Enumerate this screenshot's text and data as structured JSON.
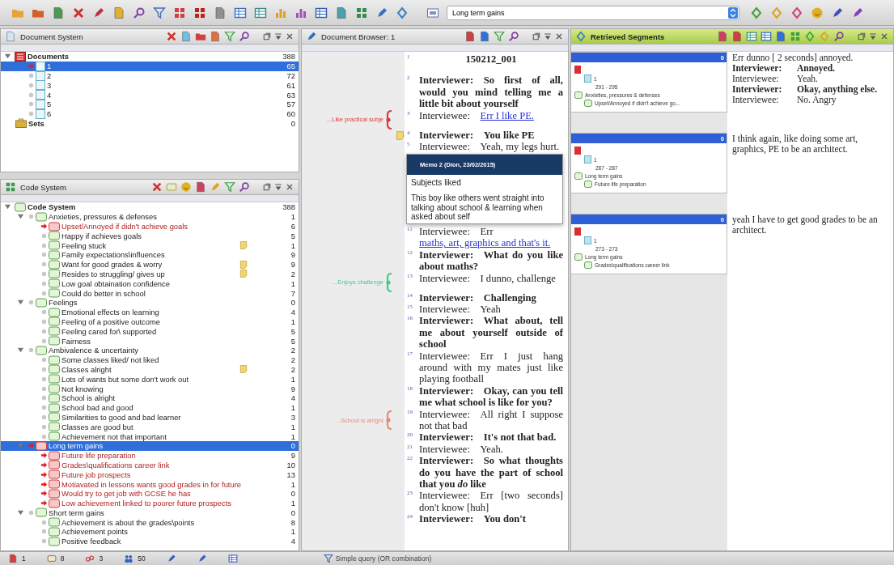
{
  "toolbar": {
    "code_dropdown": "Long term gains"
  },
  "document_system": {
    "title": "Document System",
    "root": {
      "name": "Documents",
      "count": "388",
      "expanded": true,
      "children": [
        {
          "name": "1",
          "count": "65",
          "selected": true,
          "activated": true
        },
        {
          "name": "2",
          "count": "72",
          "selected": false,
          "activated": false
        },
        {
          "name": "3",
          "count": "61",
          "selected": false,
          "activated": false
        },
        {
          "name": "4",
          "count": "63",
          "selected": false,
          "activated": false
        },
        {
          "name": "5",
          "count": "57",
          "selected": false,
          "activated": false
        },
        {
          "name": "6",
          "count": "60",
          "selected": false,
          "activated": false
        }
      ]
    },
    "sets": {
      "name": "Sets",
      "count": "0"
    }
  },
  "code_system": {
    "title": "Code System",
    "root": {
      "name": "Code System",
      "count": "388",
      "expanded": true,
      "children": [
        {
          "name": "Anxieties, pressures & defenses",
          "count": "1",
          "expanded": true,
          "selected": false,
          "activated": false,
          "children": [
            {
              "name": "Upset/Annoyed if didn't achieve goals",
              "count": "6",
              "selected": false,
              "activated": true,
              "memo": false
            },
            {
              "name": "Happy if achieves goals",
              "count": "5",
              "selected": false,
              "activated": false,
              "memo": false
            },
            {
              "name": "Feeling stuck",
              "count": "1",
              "selected": false,
              "activated": false,
              "memo": true
            },
            {
              "name": "Family expectations\\influences",
              "count": "9",
              "selected": false,
              "activated": false,
              "memo": false
            },
            {
              "name": "Want for good grades & worry",
              "count": "9",
              "selected": false,
              "activated": false,
              "memo": true
            },
            {
              "name": "Resides to struggling/ gives up",
              "count": "2",
              "selected": false,
              "activated": false,
              "memo": true
            },
            {
              "name": "Low goal obtaination confidence",
              "count": "1",
              "selected": false,
              "activated": false,
              "memo": false
            },
            {
              "name": "Could do better in school",
              "count": "7",
              "selected": false,
              "activated": false,
              "memo": false
            }
          ]
        },
        {
          "name": "Feelings",
          "count": "0",
          "expanded": true,
          "selected": false,
          "activated": false,
          "children": [
            {
              "name": "Emotional effects on learning",
              "count": "4",
              "selected": false,
              "activated": false,
              "memo": false
            },
            {
              "name": "Feeling of a positive outcome",
              "count": "1",
              "selected": false,
              "activated": false,
              "memo": false
            },
            {
              "name": "Feeling cared for\\ supported",
              "count": "5",
              "selected": false,
              "activated": false,
              "memo": false
            },
            {
              "name": "Fairness",
              "count": "5",
              "selected": false,
              "activated": false,
              "memo": false
            }
          ]
        },
        {
          "name": "Ambivalence & uncertainty",
          "count": "2",
          "expanded": true,
          "selected": false,
          "activated": false,
          "children": [
            {
              "name": "Some classes liked/ not liked",
              "count": "2",
              "selected": false,
              "activated": false,
              "memo": false
            },
            {
              "name": "Classes alright",
              "count": "2",
              "selected": false,
              "activated": false,
              "memo": true
            },
            {
              "name": "Lots of wants but some don't work out",
              "count": "1",
              "selected": false,
              "activated": false,
              "memo": false
            },
            {
              "name": "Not knowing",
              "count": "9",
              "selected": false,
              "activated": false,
              "memo": false
            },
            {
              "name": "School is alright",
              "count": "4",
              "selected": false,
              "activated": false,
              "memo": false
            },
            {
              "name": "School bad and good",
              "count": "1",
              "selected": false,
              "activated": false,
              "memo": false
            },
            {
              "name": "Similarities to good and bad learner",
              "count": "3",
              "selected": false,
              "activated": false,
              "memo": false
            },
            {
              "name": "Classes are good but",
              "count": "1",
              "selected": false,
              "activated": false,
              "memo": false
            },
            {
              "name": "Achievement not that important",
              "count": "1",
              "selected": false,
              "activated": false,
              "memo": false
            }
          ]
        },
        {
          "name": "Long term gains",
          "count": "0",
          "expanded": true,
          "selected": true,
          "activated": true,
          "children": [
            {
              "name": "Future life preparation",
              "count": "9",
              "selected": false,
              "activated": true,
              "memo": false
            },
            {
              "name": "Grades\\qualifications career link",
              "count": "10",
              "selected": false,
              "activated": true,
              "memo": false
            },
            {
              "name": "Future job prospects",
              "count": "13",
              "selected": false,
              "activated": true,
              "memo": false
            },
            {
              "name": "Motiavated in lessons wants good grades in for future",
              "count": "1",
              "selected": false,
              "activated": true,
              "memo": false
            },
            {
              "name": "Would try to get job with GCSE he has",
              "count": "0",
              "selected": false,
              "activated": true,
              "memo": false
            },
            {
              "name": "Low achievement linked to poorer future prospects",
              "count": "1",
              "selected": false,
              "activated": true,
              "memo": false
            }
          ]
        },
        {
          "name": "Short term gains",
          "count": "0",
          "expanded": true,
          "selected": false,
          "activated": false,
          "children": [
            {
              "name": "Achievement is about the grades\\points",
              "count": "8",
              "selected": false,
              "activated": false,
              "memo": false
            },
            {
              "name": "Achievement points",
              "count": "1",
              "selected": false,
              "activated": false,
              "memo": false
            },
            {
              "name": "Positive feedback",
              "count": "4",
              "selected": false,
              "activated": false,
              "memo": false
            }
          ]
        }
      ]
    }
  },
  "document_browser": {
    "title": "Document Browser: 1",
    "lines": [
      {
        "kind": "title",
        "n": "1",
        "text": "150212_001"
      },
      {
        "kind": "interviewer",
        "n": "2",
        "speaker": "Interviewer:",
        "text": "So first of all, would you mind telling me a little bit about yourself"
      },
      {
        "kind": "interviewee",
        "n": "3",
        "speaker": "Interviewee:",
        "link": "Err I like PE",
        "after": ".",
        "code": {
          "label": "...Like practical subje",
          "color": "#e0393e"
        }
      },
      {
        "kind": "interviewer",
        "n": "4",
        "speaker": "Interviewer:",
        "text": "You like PE",
        "memo": true
      },
      {
        "kind": "interviewee",
        "n": "5",
        "speaker": "Interviewee:",
        "text": "Yeah, my legs hurt."
      },
      {
        "kind": "memo",
        "title": "Memo 2 (Dion, 23/02/2015)",
        "subject": "Subjects liked",
        "body": "This boy like others went straight into talking about school & learning when asked about self"
      },
      {
        "kind": "interviewee",
        "n": "11",
        "speaker": "Interviewee:",
        "text": "Err",
        "link": "maths, art, graphics and that's it",
        "after": "."
      },
      {
        "kind": "interviewer",
        "n": "12",
        "speaker": "Interviewer:",
        "text": "What do you like about maths?"
      },
      {
        "kind": "interviewee",
        "n": "13",
        "speaker": "Interviewee:",
        "text": "I dunno, challenge",
        "code": {
          "label": "...Enjoys challenge",
          "color": "#3ecf8e"
        }
      },
      {
        "kind": "interviewer",
        "n": "14",
        "speaker": "Interviewer:",
        "text": "Challenging"
      },
      {
        "kind": "interviewee",
        "n": "15",
        "speaker": "Interviewee:",
        "text": "Yeah"
      },
      {
        "kind": "interviewer",
        "n": "16",
        "speaker": "Interviewer:",
        "text": "What about, tell me about yourself outside of school"
      },
      {
        "kind": "interviewee",
        "n": "17",
        "speaker": "Interviewee:",
        "text": "Err I just hang around with my mates just like playing football"
      },
      {
        "kind": "interviewer",
        "n": "18",
        "speaker": "Interviewer:",
        "text": "Okay, can you tell me what school is like for you?"
      },
      {
        "kind": "interviewee",
        "n": "19",
        "speaker": "Interviewee:",
        "text": "All right I suppose not that bad",
        "code": {
          "label": "...School is alright",
          "color": "#e88a7a"
        }
      },
      {
        "kind": "interviewer",
        "n": "20",
        "speaker": "Interviewer:",
        "text": "It's not that bad."
      },
      {
        "kind": "interviewee",
        "n": "21",
        "speaker": "Interviewee:",
        "text": "Yeah."
      },
      {
        "kind": "interviewer",
        "n": "22",
        "speaker": "Interviewer:",
        "text": "So what thoughts do you have the part of school that you *do* like"
      },
      {
        "kind": "interviewee",
        "n": "23",
        "speaker": "Interviewee:",
        "text": "Err [two seconds] don't know [huh]"
      },
      {
        "kind": "interviewer",
        "n": "24",
        "speaker": "Interviewer:",
        "text": "You don't"
      }
    ]
  },
  "retrieved_segments": {
    "title": "Retrieved Segments",
    "segments": [
      {
        "weight": "0",
        "document": "1",
        "range": "291 - 295",
        "code_parent": "Anxieties, pressures & defenses",
        "code": "Upset/Annoyed if didn't achieve go...",
        "lines": [
          {
            "kind": "plain",
            "text": "Err dunno [ 2 seconds] annoyed."
          },
          {
            "kind": "interviewer",
            "speaker": "Interviewer:",
            "text": "Annoyed."
          },
          {
            "kind": "interviewee",
            "speaker": "Interviewee:",
            "text": "Yeah."
          },
          {
            "kind": "interviewer",
            "speaker": "Interviewer:",
            "text": "Okay, anything else."
          },
          {
            "kind": "interviewee",
            "speaker": "Interviewee:",
            "text": "No. Angry"
          }
        ]
      },
      {
        "weight": "0",
        "document": "1",
        "range": "287 - 287",
        "code_parent": "Long term gains",
        "code": "Future life preparation",
        "text": "I think again, like doing some art, graphics, PE to be an architect."
      },
      {
        "weight": "0",
        "document": "1",
        "range": "273 - 273",
        "code_parent": "Long term gains",
        "code": "Grades\\qualifications career link",
        "text": "yeah I have to get good grades to be an architect."
      }
    ]
  },
  "status_bar": {
    "counts": [
      "1",
      "8",
      "3",
      "50"
    ],
    "query": "Simple query (OR combination)"
  }
}
